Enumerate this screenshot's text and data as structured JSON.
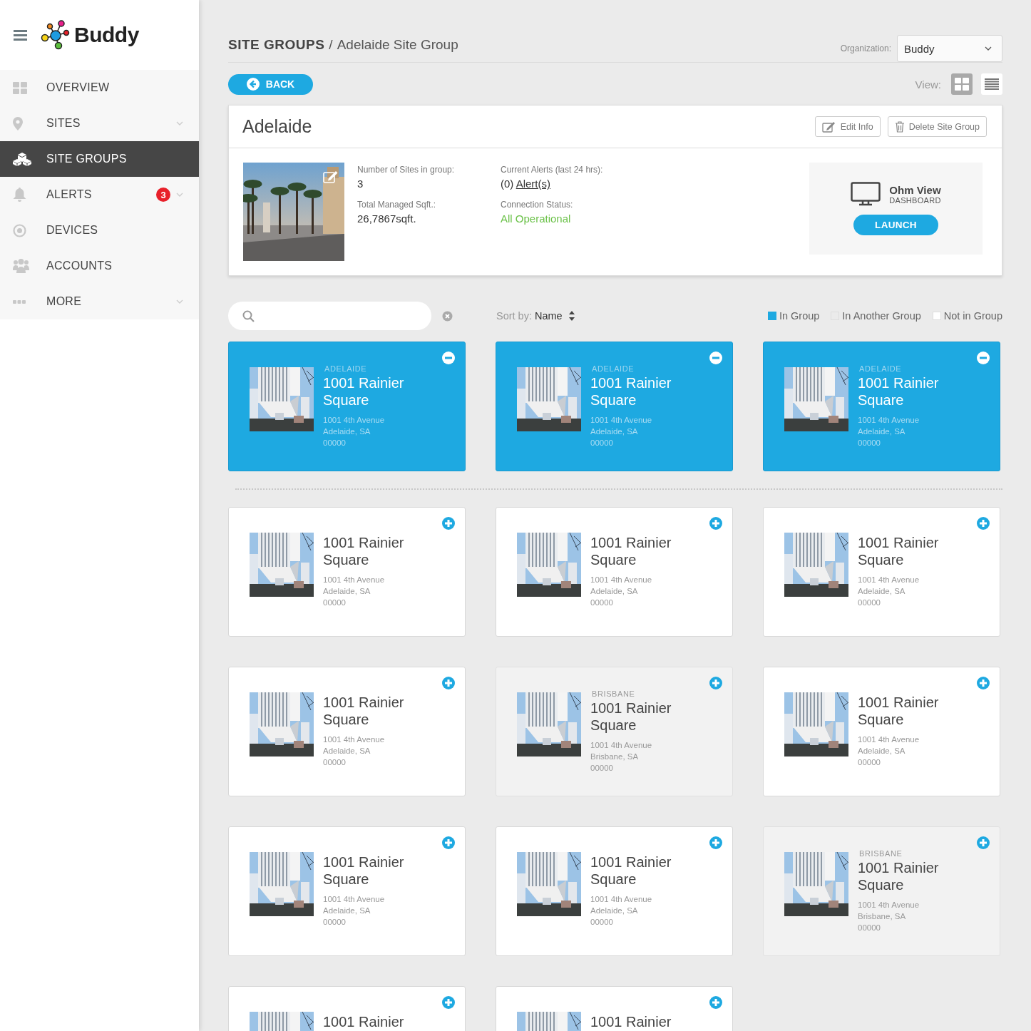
{
  "sidebar": {
    "brand": "Buddy",
    "items": [
      {
        "label": "OVERVIEW",
        "kind": "grid",
        "selected": false,
        "has_submenu": false
      },
      {
        "label": "SITES",
        "kind": "pin",
        "selected": false,
        "has_submenu": true
      },
      {
        "label": "SITE GROUPS",
        "kind": "boxes",
        "selected": true,
        "has_submenu": false
      },
      {
        "label": "ALERTS",
        "kind": "bell",
        "selected": false,
        "has_submenu": true,
        "badge": "3"
      },
      {
        "label": "DEVICES",
        "kind": "target",
        "selected": false,
        "has_submenu": false
      },
      {
        "label": "ACCOUNTS",
        "kind": "people",
        "selected": false,
        "has_submenu": false
      },
      {
        "label": "MORE",
        "kind": "dots",
        "selected": false,
        "has_submenu": true
      }
    ]
  },
  "header": {
    "section": "SITE GROUPS",
    "separator": "/",
    "page": "Adelaide Site Group",
    "organization_label": "Organization:",
    "organization": "Buddy"
  },
  "toolbar": {
    "back": "BACK",
    "view_label": "View:",
    "views": [
      {
        "kind": "grid",
        "selected": true
      },
      {
        "kind": "list",
        "selected": false
      }
    ]
  },
  "group": {
    "title": "Adelaide",
    "actions": [
      {
        "kind": "edit",
        "label": "Edit Info"
      },
      {
        "kind": "delete",
        "label": "Delete Site Group"
      }
    ],
    "stats": [
      {
        "kind": "plain",
        "label": "Number of Sites in group:",
        "value": "3"
      },
      {
        "kind": "link",
        "label": "Current Alerts (last 24 hrs):",
        "value": "(0)",
        "link": "Alert(s)"
      },
      {
        "kind": "plain",
        "label": "Total Managed Sqft.:",
        "value": "26,7867sqft."
      },
      {
        "kind": "status",
        "label": "Connection Status:",
        "value": "All Operational"
      }
    ],
    "dashboard": {
      "title": "Ohm View",
      "subtitle": "DASHBOARD",
      "button": "LAUNCH"
    }
  },
  "filters": {
    "sort_label": "Sort by:",
    "sort_value": "Name",
    "legend": [
      {
        "label": "In Group",
        "color": "#1ea9e1"
      },
      {
        "label": "In Another Group",
        "color": "#ebebeb"
      },
      {
        "label": "Not in Group",
        "color": "#ffffff"
      }
    ]
  },
  "in_group_sites": [
    {
      "kind": "in_group",
      "city": "ADELAIDE",
      "name": "1001 Rainier Square",
      "lines": [
        "1001 4th Avenue",
        "Adelaide, SA",
        "00000"
      ]
    },
    {
      "kind": "in_group",
      "city": "ADELAIDE",
      "name": "1001 Rainier Square",
      "lines": [
        "1001 4th Avenue",
        "Adelaide, SA",
        "00000"
      ]
    },
    {
      "kind": "in_group",
      "city": "ADELAIDE",
      "name": "1001 Rainier Square",
      "lines": [
        "1001 4th Avenue",
        "Adelaide, SA",
        "00000"
      ]
    }
  ],
  "other_sites": [
    {
      "kind": "free",
      "name": "1001 Rainier Square",
      "lines": [
        "1001 4th Avenue",
        "Adelaide, SA",
        "00000"
      ]
    },
    {
      "kind": "free",
      "name": "1001 Rainier Square",
      "lines": [
        "1001 4th Avenue",
        "Adelaide, SA",
        "00000"
      ]
    },
    {
      "kind": "free",
      "name": "1001 Rainier Square",
      "lines": [
        "1001 4th Avenue",
        "Adelaide, SA",
        "00000"
      ]
    },
    {
      "kind": "free",
      "name": "1001 Rainier Square",
      "lines": [
        "1001 4th Avenue",
        "Adelaide, SA",
        "00000"
      ]
    },
    {
      "kind": "another",
      "city": "BRISBANE",
      "name": "1001 Rainier Square",
      "lines": [
        "1001 4th Avenue",
        "Brisbane, SA",
        "00000"
      ]
    },
    {
      "kind": "free",
      "name": "1001 Rainier Square",
      "lines": [
        "1001 4th Avenue",
        "Adelaide, SA",
        "00000"
      ]
    },
    {
      "kind": "free",
      "name": "1001 Rainier Square",
      "lines": [
        "1001 4th Avenue",
        "Adelaide, SA",
        "00000"
      ]
    },
    {
      "kind": "free",
      "name": "1001 Rainier Square",
      "lines": [
        "1001 4th Avenue",
        "Adelaide, SA",
        "00000"
      ]
    },
    {
      "kind": "another",
      "city": "BRISBANE",
      "name": "1001 Rainier Square",
      "lines": [
        "1001 4th Avenue",
        "Brisbane, SA",
        "00000"
      ]
    },
    {
      "kind": "free",
      "name": "1001 Rainier"
    },
    {
      "kind": "free",
      "name": "1001 Rainier"
    }
  ]
}
